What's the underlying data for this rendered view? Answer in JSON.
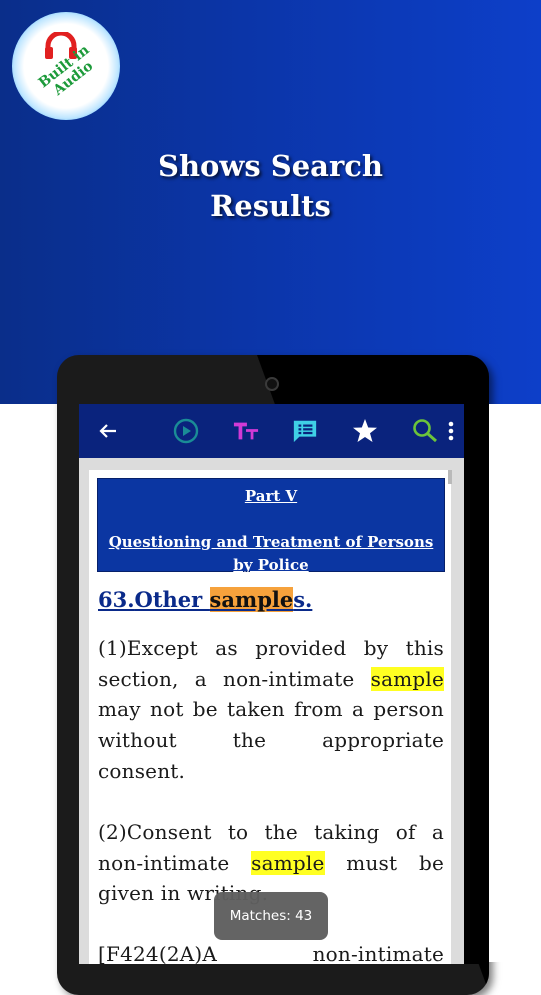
{
  "promo": {
    "badge_text": "Built in Audio",
    "headline_line1": "Shows Search",
    "headline_line2": "Results"
  },
  "toolbar": {
    "icons": [
      "back-arrow-icon",
      "play-circle-icon",
      "text-size-icon",
      "notes-icon",
      "star-icon",
      "search-icon",
      "more-vert-icon"
    ],
    "colors": {
      "background": "#0a237d",
      "back": "#ffffff",
      "play": "#1a8c96",
      "text_size": "#d23ad6",
      "notes": "#3fd0e6",
      "star": "#ffffff",
      "search": "#6cc43a"
    }
  },
  "document": {
    "part_label": "Part V",
    "part_title": "Questioning and Treatment of Persons by Police",
    "section_number": "63.",
    "section_title_before": "Other ",
    "section_title_highlight": "sample",
    "section_title_after": "s.",
    "para1": {
      "line1": "(1)Except as provided by this",
      "line2_before": "section, a non-intimate ",
      "line2_highlight": "sample",
      "line3": "may not be taken from a person",
      "line4": "without the appropriate",
      "line5": "consent."
    },
    "para2": {
      "line1": "(2)Consent to the taking of a",
      "line2_before": "non-intimate ",
      "line2_highlight": "sample",
      "line2_after": " must be",
      "line3": "given in writing."
    },
    "para3": {
      "line1": "[F424(2A)A non-intimate"
    }
  },
  "search": {
    "matches_text": "Matches: 43",
    "current_highlight_color": "#f6a23c",
    "match_highlight_color": "#ffff22"
  }
}
